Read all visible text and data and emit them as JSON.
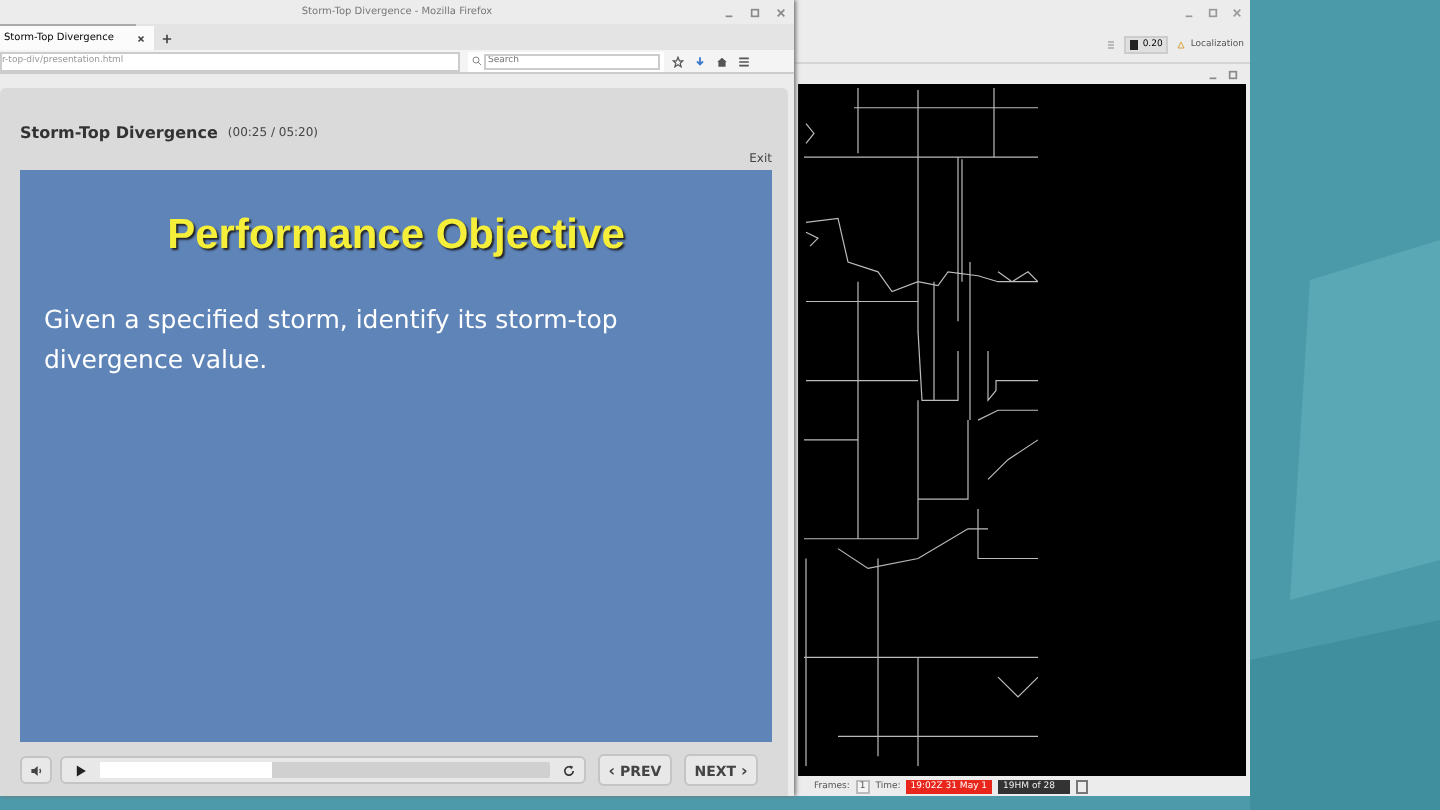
{
  "browser": {
    "title": "Storm-Top Divergence - Mozilla Firefox",
    "tabs": [
      {
        "label": "Storm-Top Divergence",
        "selected": true
      }
    ],
    "address": "r-top-div/presentation.html",
    "search": {
      "placeholder": "Search"
    }
  },
  "lesson": {
    "title": "Storm-Top Divergence",
    "time": "(00:25 / 05:20)",
    "exit": "Exit",
    "slide": {
      "heading": "Performance Objective",
      "body": "Given a specified storm, identify its storm-top divergence value."
    },
    "player": {
      "level": 0.38,
      "prev": "PREV",
      "next": "NEXT",
      "prev_glyph": "‹",
      "next_glyph": "›"
    }
  },
  "viewer": {
    "toolbar": [
      {
        "kind": "toggle",
        "label": "0.20"
      },
      {
        "kind": "link",
        "label": "Localization"
      }
    ],
    "status": {
      "frames_label": "Frames:",
      "frames": "1",
      "time_label": "Time:",
      "time": "19:02Z 31 May 1",
      "frame_time": "19HM of 28"
    }
  }
}
